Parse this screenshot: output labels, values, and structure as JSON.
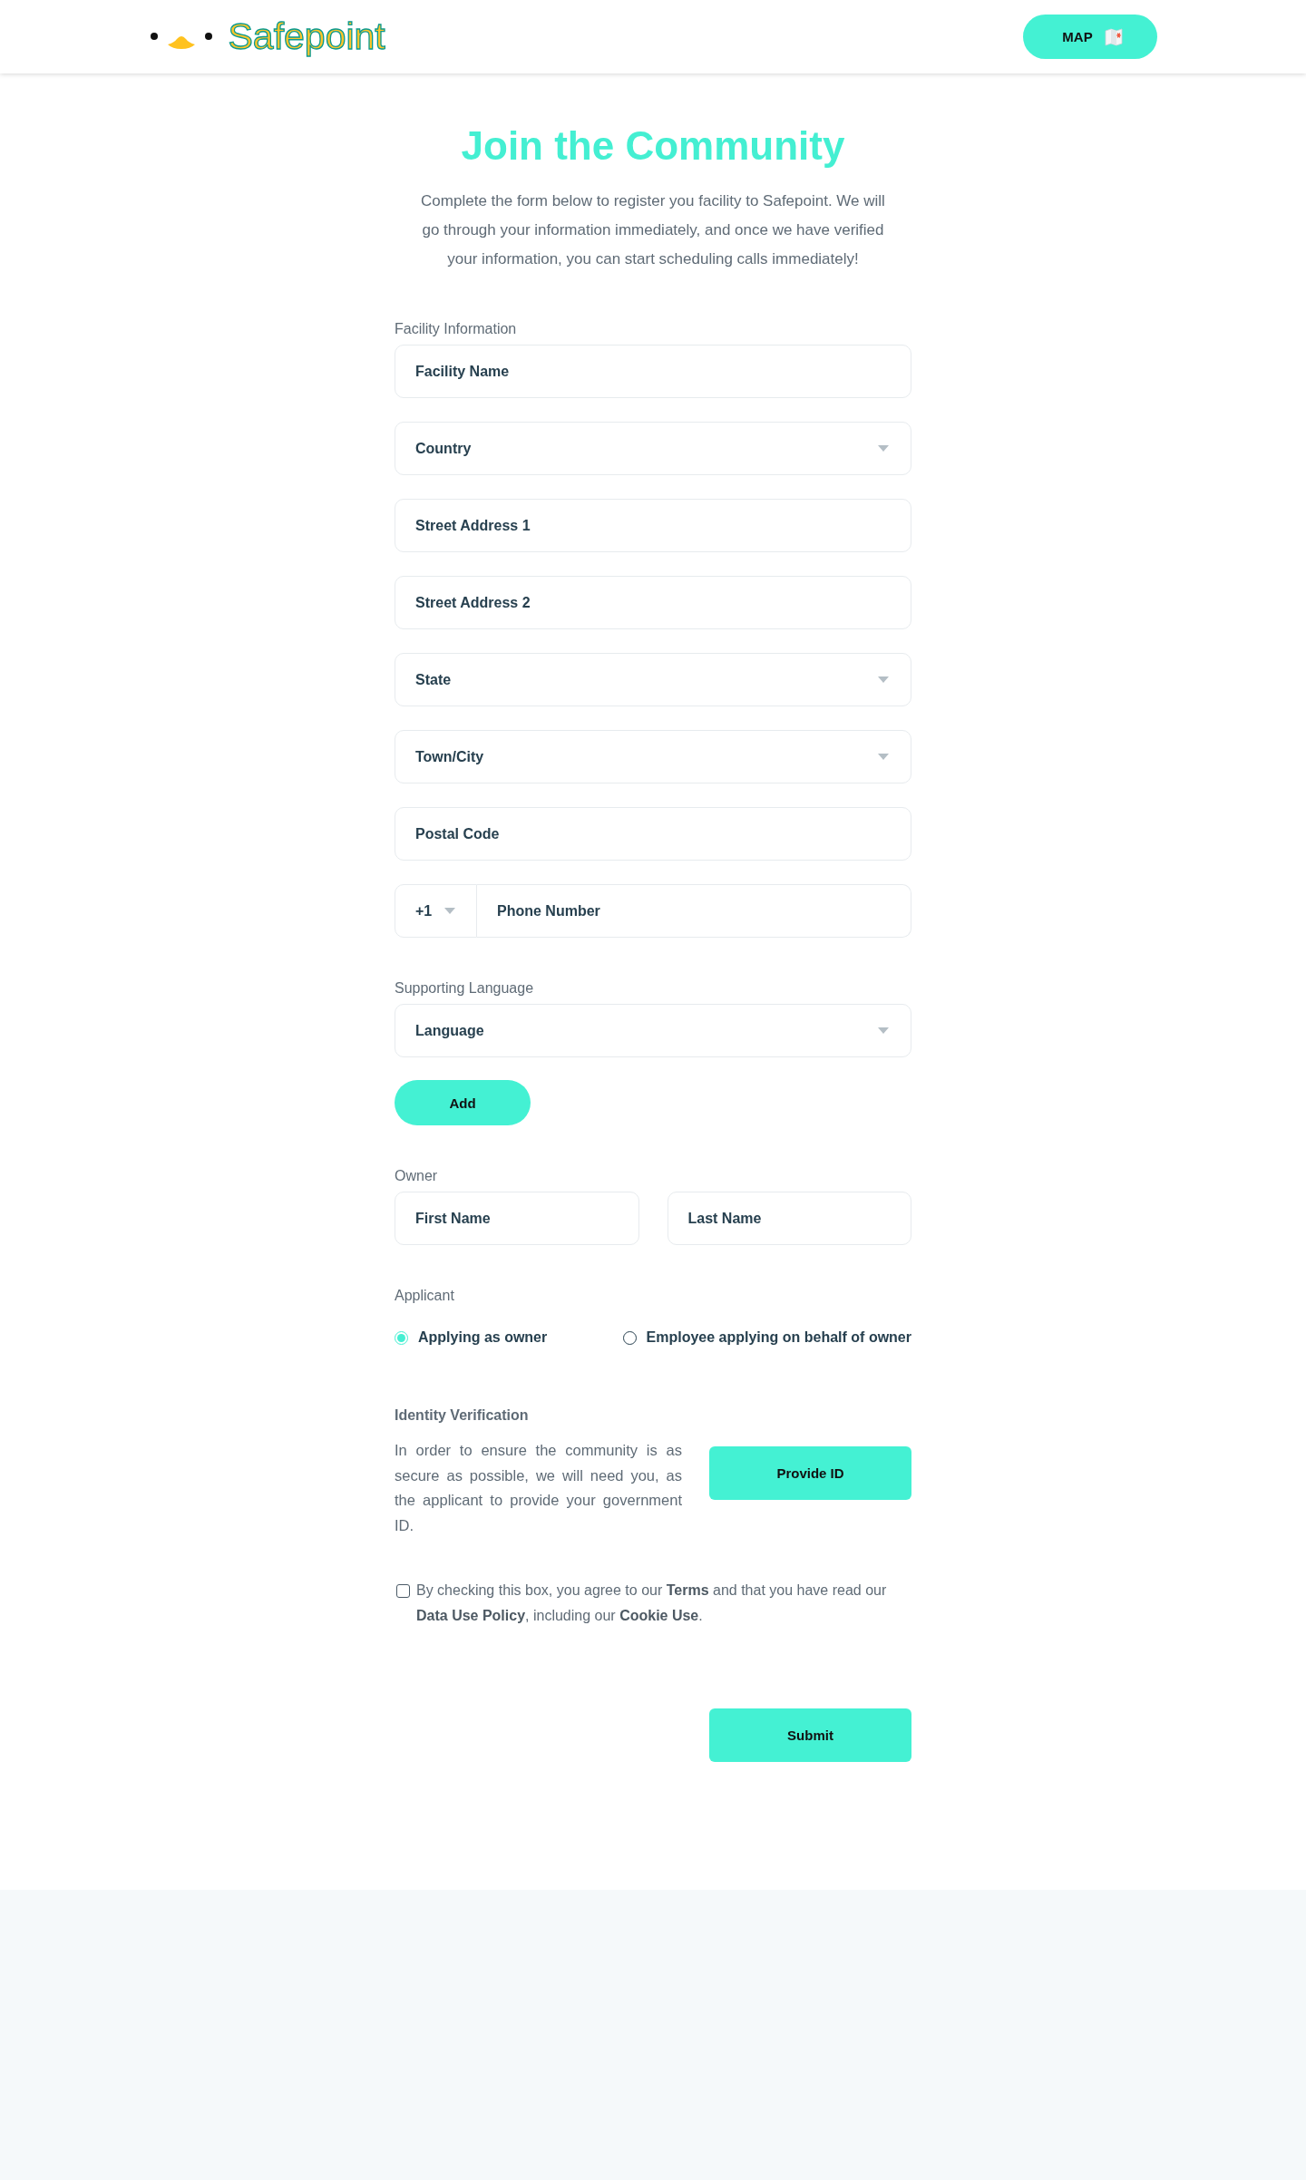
{
  "header": {
    "logo": {
      "wordmark": "Safepoint"
    },
    "map_button": {
      "label": "MAP"
    }
  },
  "intro": {
    "title": "Join the Community",
    "text": "Complete the form below to register you facility to Safepoint. We will go through your information immediately, and once we have verified your information, you can start scheduling calls immediately!"
  },
  "facility": {
    "label": "Facility Information",
    "fields": [
      {
        "kind": "text",
        "placeholder": "Facility Name"
      },
      {
        "kind": "select",
        "placeholder": "Country"
      },
      {
        "kind": "text",
        "placeholder": "Street Address 1"
      },
      {
        "kind": "text",
        "placeholder": "Street Address 2"
      },
      {
        "kind": "select",
        "placeholder": "State"
      },
      {
        "kind": "select",
        "placeholder": "Town/City"
      },
      {
        "kind": "text",
        "placeholder": "Postal Code"
      },
      {
        "kind": "phone",
        "code": "+1",
        "placeholder": "Phone Number"
      }
    ]
  },
  "language": {
    "label": "Supporting Language",
    "fields": [
      {
        "kind": "select",
        "placeholder": "Language"
      }
    ],
    "add_button": "Add"
  },
  "owner": {
    "label": "Owner",
    "fields": [
      {
        "kind": "text",
        "placeholder": "First Name"
      },
      {
        "kind": "text",
        "placeholder": "Last Name"
      }
    ]
  },
  "applicant": {
    "label": "Applicant",
    "options": [
      {
        "label": "Applying as owner",
        "selected": true
      },
      {
        "label": "Employee applying on behalf of owner",
        "selected": false
      }
    ]
  },
  "identity": {
    "label": "Identity Verification",
    "text": "In order to ensure the community is as secure as possible, we will need you, as the applicant to provide your government ID.",
    "button": "Provide ID"
  },
  "agreement": {
    "checked": false,
    "text": "By checking this box, you agree to our **Terms** and that you have read our **Data Use Policy**, including our **Cookie Use**."
  },
  "submit_button": "Submit"
}
